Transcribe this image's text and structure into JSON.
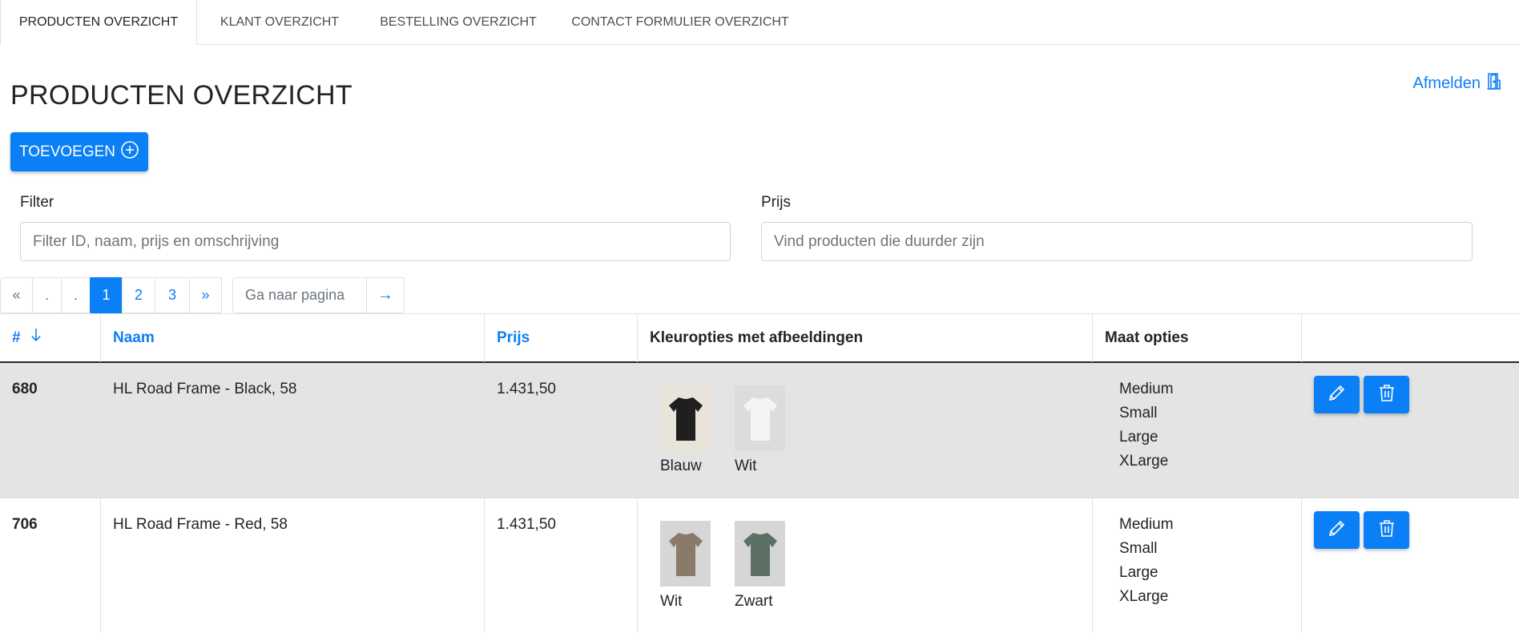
{
  "tabs": [
    {
      "label": "PRODUCTEN OVERZICHT",
      "active": true
    },
    {
      "label": "KLANT OVERZICHT",
      "active": false
    },
    {
      "label": "BESTELLING OVERZICHT",
      "active": false
    },
    {
      "label": "CONTACT FORMULIER OVERZICHT",
      "active": false
    }
  ],
  "page_title": "PRODUCTEN OVERZICHT",
  "logout_label": "Afmelden",
  "add_button_label": "TOEVOEGEN",
  "filters": {
    "filter_label": "Filter",
    "filter_placeholder": "Filter ID, naam, prijs en omschrijving",
    "price_label": "Prijs",
    "price_placeholder": "Vind producten die duurder zijn"
  },
  "pagination": {
    "first": "«",
    "dot1": ".",
    "dot2": ".",
    "pages": [
      "1",
      "2",
      "3"
    ],
    "current": "1",
    "last": "»",
    "goto_placeholder": "Ga naar pagina",
    "go": "→"
  },
  "table": {
    "headers": {
      "id": "#",
      "name": "Naam",
      "price": "Prijs",
      "colors": "Kleuropties met afbeeldingen",
      "sizes": "Maat opties"
    },
    "rows": [
      {
        "id": "680",
        "name": "HL Road Frame - Black, 58",
        "price": "1.431,50",
        "colors": [
          {
            "label": "Blauw",
            "shirt": "#1f1f1f",
            "bg": "#e9e4da"
          },
          {
            "label": "Wit",
            "shirt": "#f4f4f4",
            "bg": "#dcdcdc"
          }
        ],
        "sizes": [
          "Medium",
          "Small",
          "Large",
          "XLarge"
        ]
      },
      {
        "id": "706",
        "name": "HL Road Frame - Red, 58",
        "price": "1.431,50",
        "colors": [
          {
            "label": "Wit",
            "shirt": "#8a7a69",
            "bg": "#d6d6d6"
          },
          {
            "label": "Zwart",
            "shirt": "#5d7066",
            "bg": "#d6d6d6"
          }
        ],
        "sizes": [
          "Medium",
          "Small",
          "Large",
          "XLarge"
        ]
      }
    ]
  },
  "colors": {
    "accent": "#0b7ff5",
    "highlight_row": "#e4e4e4"
  },
  "icons": {
    "logout": "door-icon",
    "add": "plus-circle-icon",
    "edit": "pencil-icon",
    "delete": "trash-icon",
    "sort": "arrow-down-icon"
  }
}
